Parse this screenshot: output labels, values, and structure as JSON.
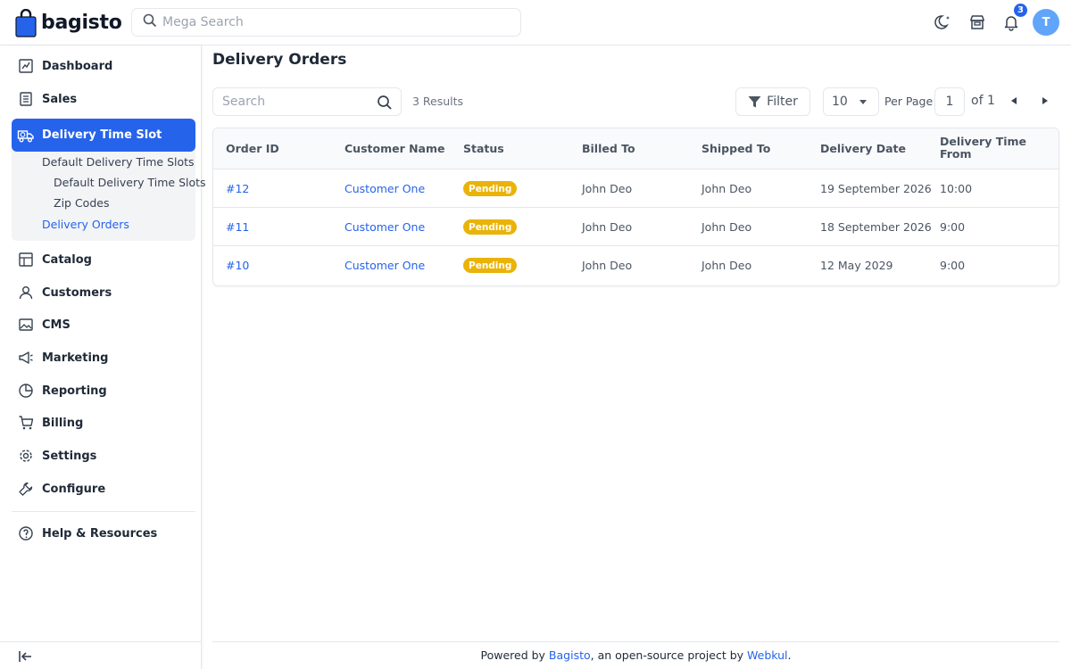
{
  "brand": {
    "name": "bagisto"
  },
  "header": {
    "search_placeholder": "Mega Search",
    "notification_count": "3",
    "avatar_initial": "T"
  },
  "sidebar": {
    "items": [
      {
        "label": "Dashboard",
        "icon": "dashboard-icon"
      },
      {
        "label": "Sales",
        "icon": "sales-icon"
      },
      {
        "label": "Delivery Time Slot",
        "icon": "delivery-truck-icon"
      },
      {
        "label": "Catalog",
        "icon": "catalog-icon"
      },
      {
        "label": "Customers",
        "icon": "customers-icon"
      },
      {
        "label": "CMS",
        "icon": "cms-icon"
      },
      {
        "label": "Marketing",
        "icon": "megaphone-icon"
      },
      {
        "label": "Reporting",
        "icon": "pie-chart-icon"
      },
      {
        "label": "Billing",
        "icon": "cart-icon"
      },
      {
        "label": "Settings",
        "icon": "gear-icon"
      },
      {
        "label": "Configure",
        "icon": "wrench-icon"
      },
      {
        "label": "Help & Resources",
        "icon": "help-icon"
      }
    ],
    "subitems": [
      {
        "label": "Default Delivery Time Slots"
      },
      {
        "label": "Default Delivery Time Slots"
      },
      {
        "label": "Zip Codes"
      },
      {
        "label": "Delivery Orders"
      }
    ]
  },
  "main": {
    "title": "Delivery Orders",
    "search_placeholder": "Search",
    "results_text": "3 Results",
    "filter_label": "Filter",
    "per_page_value": "10",
    "per_page_label": "Per Page",
    "current_page": "1",
    "of_pages": "of 1"
  },
  "table": {
    "columns": [
      "Order ID",
      "Customer Name",
      "Status",
      "Billed To",
      "Shipped To",
      "Delivery Date",
      "Delivery Time From"
    ],
    "rows": [
      {
        "order_id": "#12",
        "customer": "Customer One",
        "status": "Pending",
        "billed_to": "John Deo",
        "shipped_to": "John Deo",
        "delivery_date": "19 September 2026",
        "time_from": "10:00"
      },
      {
        "order_id": "#11",
        "customer": "Customer One",
        "status": "Pending",
        "billed_to": "John Deo",
        "shipped_to": "John Deo",
        "delivery_date": "18 September 2026",
        "time_from": "9:00"
      },
      {
        "order_id": "#10",
        "customer": "Customer One",
        "status": "Pending",
        "billed_to": "John Deo",
        "shipped_to": "John Deo",
        "delivery_date": "12 May 2029",
        "time_from": "9:00"
      }
    ]
  },
  "footer": {
    "prefix": "Powered by ",
    "bagisto_link": "Bagisto",
    "middle": ", an open-source project by ",
    "webkul_link": "Webkul",
    "suffix": "."
  },
  "colors": {
    "accent": "#2563eb",
    "pending": "#eab308",
    "avatar": "#60a5fa"
  }
}
